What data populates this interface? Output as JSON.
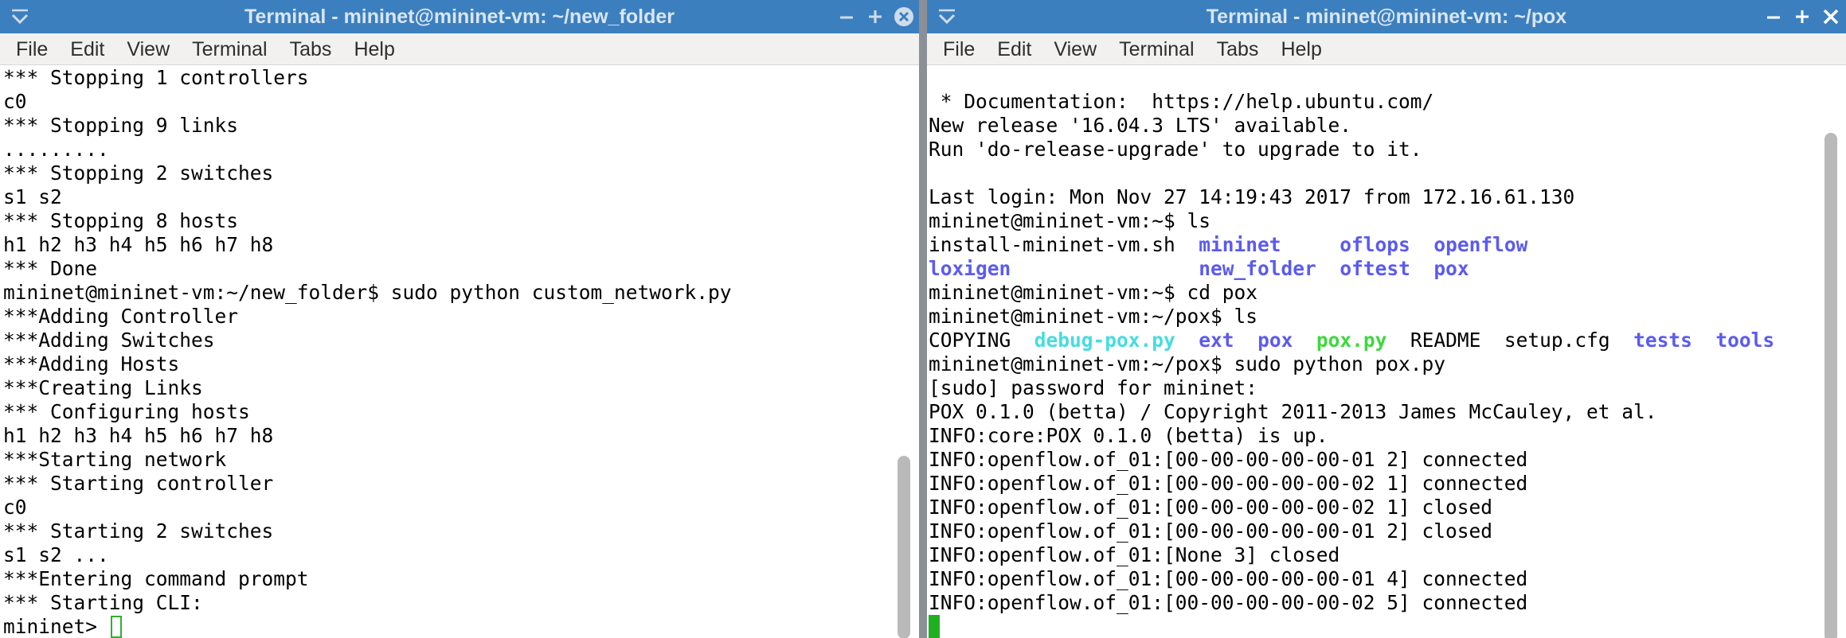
{
  "windows": {
    "left": {
      "title": "Terminal - mininet@mininet-vm: ~/new_folder",
      "menu": [
        "File",
        "Edit",
        "View",
        "Terminal",
        "Tabs",
        "Help"
      ],
      "lines": [
        [
          {
            "t": "*** Stopping 1 controllers"
          }
        ],
        [
          {
            "t": "c0"
          }
        ],
        [
          {
            "t": "*** Stopping 9 links"
          }
        ],
        [
          {
            "t": "........."
          }
        ],
        [
          {
            "t": "*** Stopping 2 switches"
          }
        ],
        [
          {
            "t": "s1 s2"
          }
        ],
        [
          {
            "t": "*** Stopping 8 hosts"
          }
        ],
        [
          {
            "t": "h1 h2 h3 h4 h5 h6 h7 h8"
          }
        ],
        [
          {
            "t": "*** Done"
          }
        ],
        [
          {
            "t": "mininet@mininet-vm:~/new_folder$ sudo python custom_network.py"
          }
        ],
        [
          {
            "t": "***Adding Controller"
          }
        ],
        [
          {
            "t": "***Adding Switches"
          }
        ],
        [
          {
            "t": "***Adding Hosts"
          }
        ],
        [
          {
            "t": "***Creating Links"
          }
        ],
        [
          {
            "t": "*** Configuring hosts"
          }
        ],
        [
          {
            "t": "h1 h2 h3 h4 h5 h6 h7 h8"
          }
        ],
        [
          {
            "t": "***Starting network"
          }
        ],
        [
          {
            "t": "*** Starting controller"
          }
        ],
        [
          {
            "t": "c0"
          }
        ],
        [
          {
            "t": "*** Starting 2 switches"
          }
        ],
        [
          {
            "t": "s1 s2 ..."
          }
        ],
        [
          {
            "t": "***Entering command prompt"
          }
        ],
        [
          {
            "t": "*** Starting CLI:"
          }
        ],
        [
          {
            "t": "mininet> "
          }
        ]
      ]
    },
    "right": {
      "title": "Terminal - mininet@mininet-vm: ~/pox",
      "menu": [
        "File",
        "Edit",
        "View",
        "Terminal",
        "Tabs",
        "Help"
      ],
      "lines": [
        [
          {
            "t": " * Documentation:  https://help.ubuntu.com/"
          }
        ],
        [
          {
            "t": "New release '16.04.3 LTS' available."
          }
        ],
        [
          {
            "t": "Run 'do-release-upgrade' to upgrade to it."
          }
        ],
        [
          {
            "t": ""
          }
        ],
        [
          {
            "t": "Last login: Mon Nov 27 14:19:43 2017 from 172.16.61.130"
          }
        ],
        [
          {
            "t": "mininet@mininet-vm:~$ ls"
          }
        ],
        [
          {
            "t": "install-mininet-vm.sh  "
          },
          {
            "t": "mininet",
            "c": "dir"
          },
          {
            "t": "     "
          },
          {
            "t": "oflops",
            "c": "dir"
          },
          {
            "t": "  "
          },
          {
            "t": "openflow",
            "c": "dir"
          }
        ],
        [
          {
            "t": "loxigen",
            "c": "dir"
          },
          {
            "t": "                "
          },
          {
            "t": "new_folder",
            "c": "dir"
          },
          {
            "t": "  "
          },
          {
            "t": "oftest",
            "c": "dir"
          },
          {
            "t": "  "
          },
          {
            "t": "pox",
            "c": "dir"
          }
        ],
        [
          {
            "t": "mininet@mininet-vm:~$ cd pox"
          }
        ],
        [
          {
            "t": "mininet@mininet-vm:~/pox$ ls"
          }
        ],
        [
          {
            "t": "COPYING  "
          },
          {
            "t": "debug-pox.py",
            "c": "link"
          },
          {
            "t": "  "
          },
          {
            "t": "ext",
            "c": "dir"
          },
          {
            "t": "  "
          },
          {
            "t": "pox",
            "c": "dir"
          },
          {
            "t": "  "
          },
          {
            "t": "pox.py",
            "c": "exec"
          },
          {
            "t": "  README  setup.cfg  "
          },
          {
            "t": "tests",
            "c": "dir"
          },
          {
            "t": "  "
          },
          {
            "t": "tools",
            "c": "dir"
          }
        ],
        [
          {
            "t": "mininet@mininet-vm:~/pox$ sudo python pox.py"
          }
        ],
        [
          {
            "t": "[sudo] password for mininet:"
          }
        ],
        [
          {
            "t": "POX 0.1.0 (betta) / Copyright 2011-2013 James McCauley, et al."
          }
        ],
        [
          {
            "t": "INFO:core:POX 0.1.0 (betta) is up."
          }
        ],
        [
          {
            "t": "INFO:openflow.of_01:[00-00-00-00-00-01 2] connected"
          }
        ],
        [
          {
            "t": "INFO:openflow.of_01:[00-00-00-00-00-02 1] connected"
          }
        ],
        [
          {
            "t": "INFO:openflow.of_01:[00-00-00-00-00-02 1] closed"
          }
        ],
        [
          {
            "t": "INFO:openflow.of_01:[00-00-00-00-00-01 2] closed"
          }
        ],
        [
          {
            "t": "INFO:openflow.of_01:[None 3] closed"
          }
        ],
        [
          {
            "t": "INFO:openflow.of_01:[00-00-00-00-00-01 4] connected"
          }
        ],
        [
          {
            "t": "INFO:openflow.of_01:[00-00-00-00-00-02 5] connected"
          }
        ]
      ]
    }
  },
  "colors": {
    "dir": "#5b5bf0",
    "link": "#46dce0",
    "exec": "#3ed83e",
    "text": "#000000",
    "cursor": "#21b021"
  },
  "icons": {
    "window_menu": "chevron-down-icon",
    "minimize": "minimize-icon",
    "maximize": "maximize-icon",
    "close": "close-icon"
  }
}
